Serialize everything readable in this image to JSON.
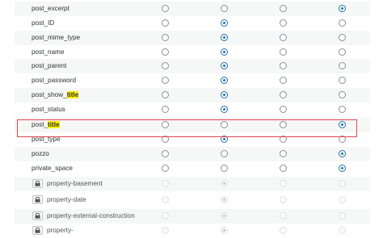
{
  "rows": [
    {
      "label": "post_excerpt",
      "pre": "post_excerpt",
      "hl": "",
      "post": "",
      "checked": 4,
      "locked": false
    },
    {
      "label": "post_ID",
      "pre": "post_ID",
      "hl": "",
      "post": "",
      "checked": 2,
      "locked": false
    },
    {
      "label": "post_mime_type",
      "pre": "post_mime_type",
      "hl": "",
      "post": "",
      "checked": 2,
      "locked": false
    },
    {
      "label": "post_name",
      "pre": "post_name",
      "hl": "",
      "post": "",
      "checked": 2,
      "locked": false
    },
    {
      "label": "post_parent",
      "pre": "post_parent",
      "hl": "",
      "post": "",
      "checked": 2,
      "locked": false
    },
    {
      "label": "post_password",
      "pre": "post_password",
      "hl": "",
      "post": "",
      "checked": 2,
      "locked": false
    },
    {
      "label": "post_show_title",
      "pre": "post_show_",
      "hl": "title",
      "post": "",
      "checked": 2,
      "locked": false
    },
    {
      "label": "post_status",
      "pre": "post_status",
      "hl": "",
      "post": "",
      "checked": 2,
      "locked": false
    },
    {
      "label": "post_title",
      "pre": "post_",
      "hl": "title",
      "post": "",
      "checked": 4,
      "locked": false
    },
    {
      "label": "post_type",
      "pre": "post_type",
      "hl": "",
      "post": "",
      "checked": 2,
      "locked": false
    },
    {
      "label": "pozzo",
      "pre": "pozzo",
      "hl": "",
      "post": "",
      "checked": 4,
      "locked": false
    },
    {
      "label": "private_space",
      "pre": "private_space",
      "hl": "",
      "post": "",
      "checked": 4,
      "locked": false
    },
    {
      "label": "property-basement",
      "pre": "property-basement",
      "hl": "",
      "post": "",
      "checked": 2,
      "locked": true
    },
    {
      "label": "property-date",
      "pre": "property-date",
      "hl": "",
      "post": "",
      "checked": 2,
      "locked": true
    },
    {
      "label": "property-external-construction",
      "pre": "property-external-construction",
      "hl": "",
      "post": "",
      "checked": 2,
      "locked": true
    },
    {
      "label": "property-",
      "pre": "property-",
      "hl": "",
      "post": "",
      "checked": 2,
      "locked": true
    }
  ],
  "icons": {
    "lock": "lock-icon",
    "radio": "radio-button"
  },
  "colors": {
    "accent": "#2271b1",
    "highlight": "#fff200",
    "box": "#e0484e"
  }
}
